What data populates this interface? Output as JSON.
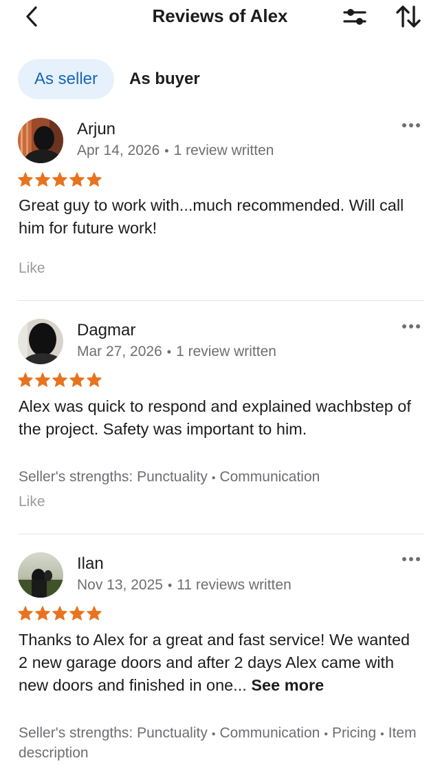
{
  "header": {
    "title": "Reviews of Alex",
    "back_icon": "chevron-left-icon",
    "filter_icon": "sliders-icon",
    "sort_icon": "sort-arrows-icon"
  },
  "tabs": [
    {
      "label": "As seller",
      "active": true
    },
    {
      "label": "As buyer",
      "active": false
    }
  ],
  "colors": {
    "accent": "#1666b8",
    "active_tab_bg": "#e6f1fb",
    "star": "#e8731e",
    "muted_text": "#6e6e73"
  },
  "reviews": [
    {
      "name": "Arjun",
      "date": "Apr 14, 2026",
      "reviews_written": "1 review written",
      "rating": 5,
      "text": "Great guy to work with...much recommended. Will call him for future work!",
      "like_label": "Like"
    },
    {
      "name": "Dagmar",
      "date": "Mar 27, 2026",
      "reviews_written": "1 review written",
      "rating": 5,
      "text": "Alex was quick to respond and explained wachbstep of the project. Safety was important to him.",
      "strengths_label": "Seller's strengths:",
      "strengths": [
        "Punctuality",
        "Communication"
      ],
      "like_label": "Like"
    },
    {
      "name": "Ilan",
      "date": "Nov 13, 2025",
      "reviews_written": "11 reviews written",
      "rating": 5,
      "text": "Thanks to Alex for a great and fast service! We wanted 2 new garage doors and after 2 days Alex came with new doors and finished in one...",
      "see_more": "See more",
      "strengths_label": "Seller's strengths:",
      "strengths": [
        "Punctuality",
        "Communication",
        "Pricing",
        "Item description"
      ]
    }
  ]
}
